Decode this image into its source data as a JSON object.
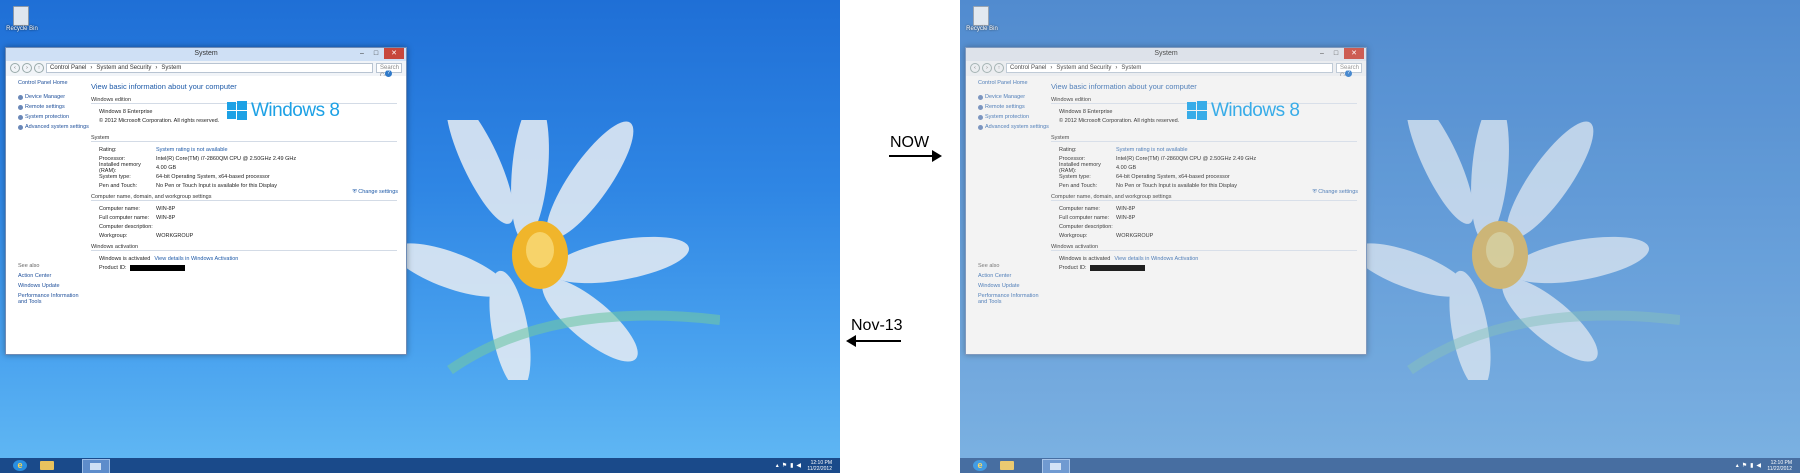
{
  "annotations": {
    "now_label": "NOW",
    "old_label": "Nov-13"
  },
  "desktop": {
    "recycle_bin_label": "Recycle Bin"
  },
  "window": {
    "title": "System",
    "controls": {
      "minimize": "–",
      "maximize": "□",
      "close": "✕"
    },
    "breadcrumb": [
      "Control Panel",
      "System and Security",
      "System"
    ],
    "search_placeholder": "Search Co...",
    "sidebar": {
      "home": "Control Panel Home",
      "items": [
        "Device Manager",
        "Remote settings",
        "System protection",
        "Advanced system settings"
      ]
    },
    "see_also": {
      "heading": "See also",
      "items": [
        "Action Center",
        "Windows Update",
        "Performance Information and Tools"
      ]
    },
    "heading": "View basic information about your computer",
    "edition": {
      "section": "Windows edition",
      "name": "Windows 8 Enterprise",
      "copyright": "© 2012 Microsoft Corporation. All rights reserved.",
      "logo_text": "Windows",
      "logo_version": "8"
    },
    "system": {
      "section": "System",
      "rows": [
        {
          "k": "Rating:",
          "v": "System rating is not available",
          "link": true
        },
        {
          "k": "Processor:",
          "v": "Intel(R) Core(TM) i7-2860QM CPU @ 2.50GHz   2.49 GHz",
          "link": false
        },
        {
          "k": "Installed memory (RAM):",
          "v": "4.00 GB",
          "link": false
        },
        {
          "k": "System type:",
          "v": "64-bit Operating System, x64-based processor",
          "link": false
        },
        {
          "k": "Pen and Touch:",
          "v": "No Pen or Touch Input is available for this Display",
          "link": false
        }
      ]
    },
    "computer": {
      "section": "Computer name, domain, and workgroup settings",
      "change_settings": "Change settings",
      "rows": [
        {
          "k": "Computer name:",
          "v": "WIN-8P"
        },
        {
          "k": "Full computer name:",
          "v": "WIN-8P"
        },
        {
          "k": "Computer description:",
          "v": ""
        },
        {
          "k": "Workgroup:",
          "v": "WORKGROUP"
        }
      ]
    },
    "activation": {
      "section": "Windows activation",
      "status": "Windows is activated",
      "details_link": "View details in Windows Activation",
      "product_id_label": "Product ID:"
    }
  },
  "taskbar": {
    "time": "12:10 PM",
    "date": "11/22/2012"
  },
  "colors": {
    "accent": "#1da1e5",
    "link": "#1e5aa8",
    "close": "#c7473c"
  }
}
